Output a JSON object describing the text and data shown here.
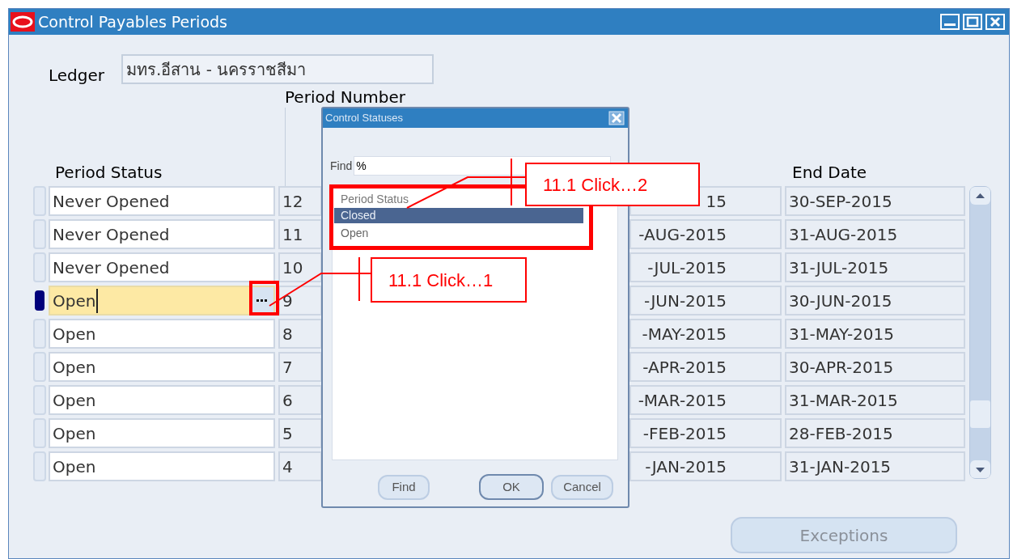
{
  "window": {
    "title": "Control Payables Periods"
  },
  "ledger": {
    "label": "Ledger",
    "value": "มทร.อีสาน - นครราชสีมา"
  },
  "columns": {
    "period_status": "Period Status",
    "period_number": "Period Number",
    "end_date": "End Date"
  },
  "rows": [
    {
      "period_status": "Never Opened",
      "period_number": "12",
      "start_date": "15",
      "end_date": "30-SEP-2015",
      "selected": false
    },
    {
      "period_status": "Never Opened",
      "period_number": "11",
      "start_date": "-AUG-2015",
      "end_date": "31-AUG-2015",
      "selected": false
    },
    {
      "period_status": "Never Opened",
      "period_number": "10",
      "start_date": "-JUL-2015",
      "end_date": "31-JUL-2015",
      "selected": false
    },
    {
      "period_status": "Open",
      "period_number": "9",
      "start_date": "-JUN-2015",
      "end_date": "30-JUN-2015",
      "selected": true
    },
    {
      "period_status": "Open",
      "period_number": "8",
      "start_date": "-MAY-2015",
      "end_date": "31-MAY-2015",
      "selected": false
    },
    {
      "period_status": "Open",
      "period_number": "7",
      "start_date": "-APR-2015",
      "end_date": "30-APR-2015",
      "selected": false
    },
    {
      "period_status": "Open",
      "period_number": "6",
      "start_date": "-MAR-2015",
      "end_date": "31-MAR-2015",
      "selected": false
    },
    {
      "period_status": "Open",
      "period_number": "5",
      "start_date": "-FEB-2015",
      "end_date": "28-FEB-2015",
      "selected": false
    },
    {
      "period_status": "Open",
      "period_number": "4",
      "start_date": "-JAN-2015",
      "end_date": "31-JAN-2015",
      "selected": false
    }
  ],
  "dialog": {
    "title": "Control Statuses",
    "find_label": "Find",
    "find_value": "%",
    "list_header": "Period Status",
    "items": [
      {
        "label": "Closed",
        "selected": true
      },
      {
        "label": "Open",
        "selected": false
      }
    ],
    "buttons": [
      "Find",
      "OK",
      "Cancel"
    ]
  },
  "exceptions_button": {
    "label": "Exceptions",
    "disabled": true
  },
  "callouts": [
    {
      "text": "11.1 Click…2"
    },
    {
      "text": "11.1 Click…1"
    }
  ]
}
